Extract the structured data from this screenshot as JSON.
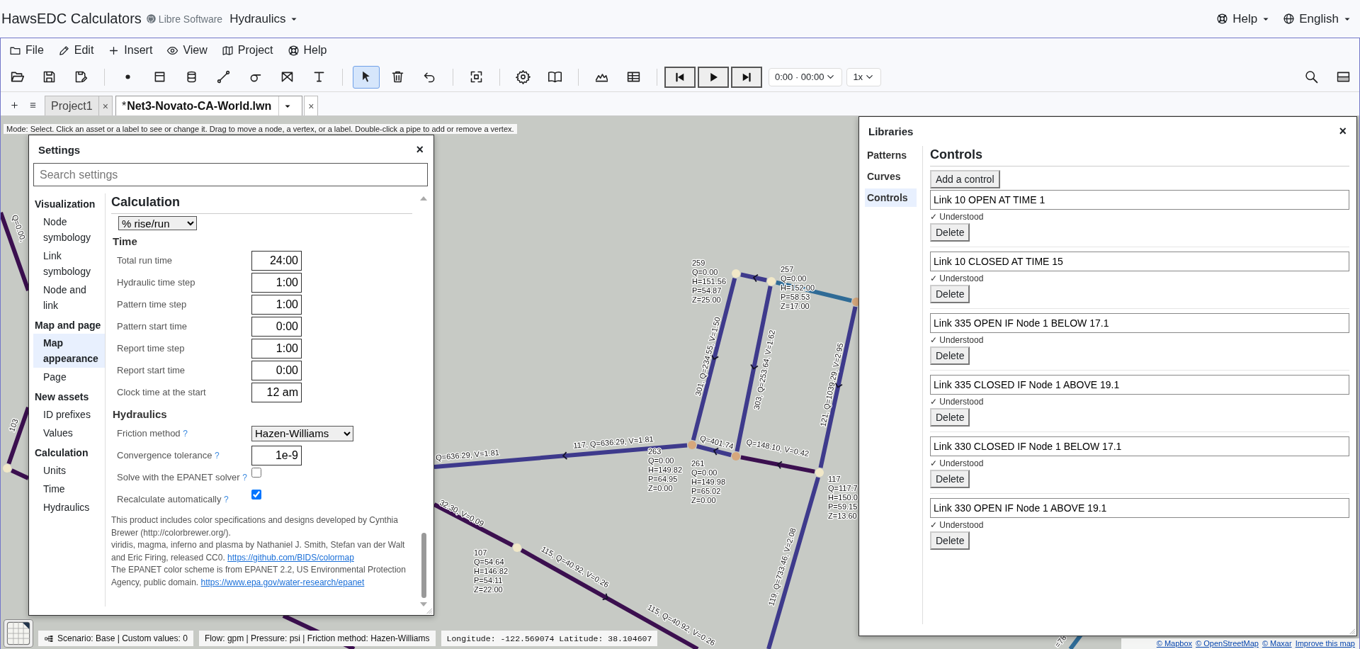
{
  "header": {
    "title": "HawsEDC Calculators",
    "source_link": "Libre Software",
    "app_menu": "Hydraulics",
    "help_menu": "Help",
    "language_menu": "English"
  },
  "menu_bar": [
    "File",
    "Edit",
    "Insert",
    "View",
    "Project",
    "Help"
  ],
  "toolbar": {
    "tools": [
      {
        "active": false
      },
      {
        "active": false
      },
      {
        "active": false
      },
      {
        "active": false
      },
      {
        "active": false
      },
      {
        "active": false
      },
      {
        "active": false
      },
      {
        "active": false
      },
      {
        "active": false
      },
      {
        "active": false
      },
      {
        "active": true
      },
      {
        "active": false
      },
      {
        "active": false
      },
      {
        "active": false
      },
      {
        "active": false
      },
      {
        "active": false
      },
      {
        "active": false
      },
      {
        "active": false
      }
    ],
    "time_select": "0:00 · 00:00",
    "speed_select": "1x"
  },
  "tabs": [
    {
      "label": "Project1",
      "selected": false,
      "close": "×"
    },
    {
      "prefix": "*",
      "label": "Net3-Novato-CA-World.lwn",
      "selected": true,
      "close": "×"
    }
  ],
  "map": {
    "mode_hint": "Mode: Select. Click an asset or a label to see or change it. Drag to move a node, a vertex, or a label. Double-click a pipe to add or remove a vertex.",
    "pipes": [
      {
        "color": "#3e3a8c"
      },
      {
        "color": "#2f6b96"
      },
      {
        "color": "#3e3a8c",
        "labels": [
          "301, Q=234.55, V=1.50"
        ]
      },
      {
        "color": "#3e3a8c",
        "labels": [
          "303, Q=253.64, V=1.62"
        ]
      },
      {
        "color": "#3e3a8c",
        "labels": [
          "121, Q=1039.29, V=2.95"
        ]
      },
      {
        "color": "#3e3a8c",
        "labels": [
          "119, Q=733.46, V=2.08"
        ]
      },
      {
        "color": "#3e3a8c",
        "labels": [
          "Q=401.74"
        ]
      },
      {
        "color": "#3b0f4f",
        "labels": [
          "Q=148.10, V=0.42"
        ]
      },
      {
        "color": "#3e3a8c",
        "labels": [
          "117, Q=636.29, V=1.81",
          "Q=636.29, V=1.81"
        ]
      },
      {
        "color": "#3b0f4f",
        "labels": [
          "32.30, V=0.09"
        ]
      },
      {
        "color": "#3b0f4f",
        "labels": [
          "115, Q=40.92, V=0.26",
          "115, Q=40.92, V=0.26"
        ]
      },
      {
        "color": "#3b0f4f",
        "labels": [
          "Q=0.00,"
        ]
      },
      {
        "color": "#3b0f4f",
        "labels": [
          "103"
        ]
      },
      {
        "color": "#3b0f4f"
      },
      {
        "color": "#3b0f4f"
      },
      {
        "color": "#2f6b96",
        "labels": [
          "=78"
        ]
      }
    ],
    "nodes": [
      {
        "color": "#f1e8c8",
        "label": [
          "259",
          "Q=0.00",
          "H=151.56",
          "P=54.87",
          "Z=25.00"
        ]
      },
      {
        "color": "#f1e8c8",
        "label": [
          "257",
          "Q=0.00",
          "H=152.00",
          "P=58.53",
          "Z=17.00"
        ]
      },
      {
        "color": "#d6a77c"
      },
      {
        "color": "#d6a77c",
        "label": [
          "263",
          "Q=0.00",
          "H=149.82",
          "P=64.95",
          "Z=0.00"
        ]
      },
      {
        "color": "#d6a77c",
        "label": [
          "261",
          "Q=0.00",
          "H=149.98",
          "P=65.02",
          "Z=0.00"
        ]
      },
      {
        "color": "#f1e8c8",
        "label": [
          "117",
          "Q=117.7",
          "H=150.0",
          "P=59.15",
          "Z=13.60"
        ]
      },
      {
        "color": "#f1e8c8",
        "label": [
          "107",
          "Q=54.64",
          "H=146.82",
          "P=54.11",
          "Z=22.00"
        ]
      },
      {
        "color": "#f1e8c8"
      }
    ],
    "attribution": [
      "© Mapbox",
      "© OpenStreetMap",
      "© Maxar",
      "Improve this map"
    ]
  },
  "settings": {
    "title": "Settings",
    "close": "×",
    "search_placeholder": "Search settings",
    "nav": [
      {
        "label": "Visualization",
        "children": [
          {
            "label": "Node symbology",
            "selected": false
          },
          {
            "label": "Link symbology",
            "selected": false
          },
          {
            "label": "Node and link",
            "selected": false
          }
        ]
      },
      {
        "label": "Map and page",
        "children": [
          {
            "label": "Map appearance",
            "selected": true
          },
          {
            "label": "Page",
            "selected": false
          }
        ]
      },
      {
        "label": "New assets",
        "children": [
          {
            "label": "ID prefixes",
            "selected": false
          },
          {
            "label": "Values",
            "selected": false
          }
        ]
      },
      {
        "label": "Calculation",
        "children": [
          {
            "label": "Units",
            "selected": false
          },
          {
            "label": "Time",
            "selected": false
          },
          {
            "label": "Hydraulics",
            "selected": false
          }
        ]
      }
    ],
    "section_title": "Calculation",
    "unit_select": "% rise/run",
    "groups": [
      {
        "title": "Time",
        "rows": [
          {
            "kind": "input",
            "label": "Total run time",
            "value": "24:00"
          },
          {
            "kind": "input",
            "label": "Hydraulic time step",
            "value": "1:00"
          },
          {
            "kind": "input",
            "label": "Pattern time step",
            "value": "1:00"
          },
          {
            "kind": "input",
            "label": "Pattern start time",
            "value": "0:00"
          },
          {
            "kind": "input",
            "label": "Report time step",
            "value": "1:00"
          },
          {
            "kind": "input",
            "label": "Report start time",
            "value": "0:00"
          },
          {
            "kind": "input",
            "label": "Clock time at the start",
            "value": "12 am"
          }
        ]
      },
      {
        "title": "Hydraulics",
        "rows": [
          {
            "kind": "select",
            "label": "Friction method",
            "help": "?",
            "value": "Hazen-Williams"
          },
          {
            "kind": "input",
            "label": "Convergence tolerance",
            "help": "?",
            "value": "1e-9"
          },
          {
            "kind": "checkbox",
            "label": "Solve with the EPANET solver",
            "help": "?",
            "checked": false
          },
          {
            "kind": "checkbox",
            "label": "Recalculate automatically",
            "help": "?",
            "checked": true
          }
        ]
      }
    ],
    "credits": [
      {
        "text": "This product includes color specifications and designs developed by Cynthia Brewer (http://colorbrewer.org/)."
      },
      {
        "text": "viridis, magma, inferno and plasma by Nathaniel J. Smith, Stefan van der Walt and Eric Firing, released CC0.",
        "link": "https://github.com/BIDS/colormap"
      },
      {
        "text": "The EPANET color scheme is from EPANET 2.2, US Environmental Protection Agency, public domain.",
        "link": "https://www.epa.gov/water-research/epanet"
      }
    ]
  },
  "libraries": {
    "title": "Libraries",
    "close": "×",
    "nav": [
      {
        "label": "Patterns",
        "selected": false
      },
      {
        "label": "Curves",
        "selected": false
      },
      {
        "label": "Controls",
        "selected": true
      }
    ],
    "section_title": "Controls",
    "add_button": "Add a control",
    "controls": [
      {
        "text": "Link 10 OPEN AT TIME 1",
        "status": "✓ Understood",
        "delete": "Delete"
      },
      {
        "text": "Link 10 CLOSED AT TIME 15",
        "status": "✓ Understood",
        "delete": "Delete"
      },
      {
        "text": "Link 335 OPEN IF Node 1 BELOW 17.1",
        "status": "✓ Understood",
        "delete": "Delete"
      },
      {
        "text": "Link 335 CLOSED IF Node 1 ABOVE 19.1",
        "status": "✓ Understood",
        "delete": "Delete"
      },
      {
        "text": "Link 330 CLOSED IF Node 1 BELOW 17.1",
        "status": "✓ Understood",
        "delete": "Delete"
      },
      {
        "text": "Link 330 OPEN IF Node 1 ABOVE 19.1",
        "status": "✓ Understood",
        "delete": "Delete"
      }
    ]
  },
  "status_bar": {
    "scenario": "Scenario: Base | Custom values: 0",
    "units": "Flow: gpm | Pressure: psi | Friction method: Hazen-Williams",
    "coordinates": "Longitude: -122.569074 Latitude: 38.104607"
  }
}
